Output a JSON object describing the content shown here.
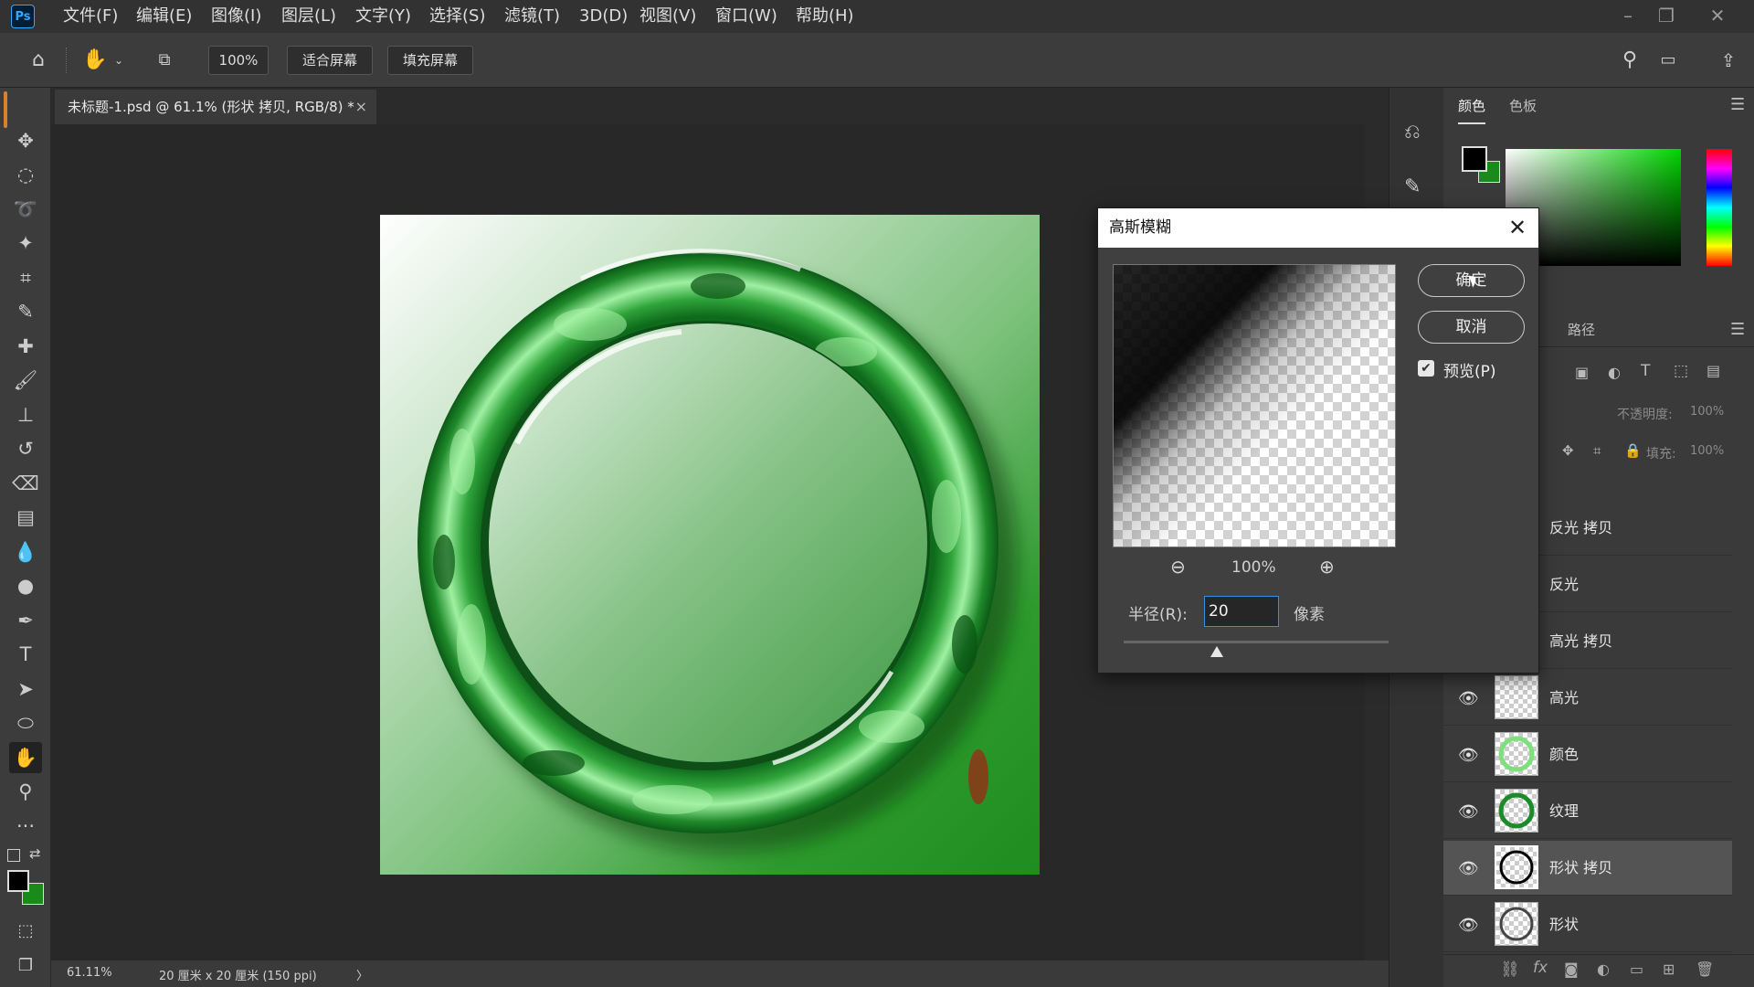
{
  "app": {
    "logo": "Ps"
  },
  "menu": [
    "文件(F)",
    "编辑(E)",
    "图像(I)",
    "图层(L)",
    "文字(Y)",
    "选择(S)",
    "滤镜(T)",
    "3D(D)",
    "视图(V)",
    "窗口(W)",
    "帮助(H)"
  ],
  "options": {
    "zoom_value": "100%",
    "fit_screen": "适合屏幕",
    "fill_screen": "填充屏幕"
  },
  "document": {
    "tab_title": "未标题-1.psd @ 61.1% (形状 拷贝, RGB/8) *",
    "close_glyph": "×"
  },
  "status": {
    "zoom": "61.11%",
    "doc_info": "20 厘米 x 20 厘米 (150 ppi)",
    "arrow": "〉"
  },
  "panels": {
    "color_tab": "颜色",
    "swatches_tab": "色板",
    "paths_tab": "路径",
    "opacity_label": "不透明度:",
    "opacity_value": "100%",
    "fill_label": "填充:",
    "fill_value": "100%"
  },
  "layers": [
    {
      "name": "反光 拷贝",
      "visible": false,
      "selected": false
    },
    {
      "name": "反光",
      "visible": false,
      "selected": false
    },
    {
      "name": "高光 拷贝",
      "visible": false,
      "selected": false
    },
    {
      "name": "高光",
      "visible": true,
      "selected": false
    },
    {
      "name": "颜色",
      "visible": true,
      "selected": false
    },
    {
      "name": "纹理",
      "visible": true,
      "selected": false
    },
    {
      "name": "形状 拷贝",
      "visible": true,
      "selected": true
    },
    {
      "name": "形状",
      "visible": true,
      "selected": false
    }
  ],
  "dialog": {
    "title": "高斯模糊",
    "ok_label": "确定",
    "cancel_label": "取消",
    "preview_label": "预览(P)",
    "preview_checked": true,
    "zoom_label": "100%",
    "radius_label": "半径(R):",
    "radius_value": "20",
    "unit_label": "像素",
    "radius_slider_fraction": 0.35
  },
  "colors": {
    "foreground": "#000000",
    "background": "#1a8a1a",
    "jade": "#2fa43a"
  }
}
